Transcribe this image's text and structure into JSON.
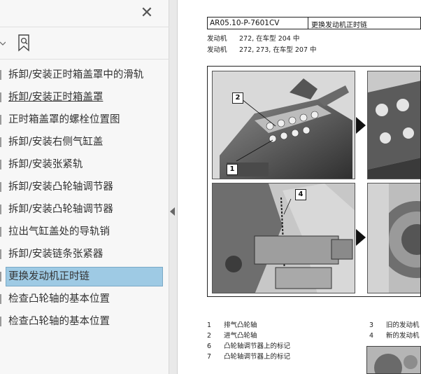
{
  "sidebar": {
    "close_glyph": "✕",
    "bookmarks": [
      {
        "label": "拆卸/安装正时箱盖罩中的滑轨"
      },
      {
        "label": "拆卸/安装正时箱盖罩"
      },
      {
        "label": "正时箱盖罩的螺栓位置图"
      },
      {
        "label": "拆卸/安装右侧气缸盖"
      },
      {
        "label": "拆卸/安装张紧轨"
      },
      {
        "label": "拆卸/安装凸轮轴调节器"
      },
      {
        "label": "拆卸/安装凸轮轴调节器"
      },
      {
        "label": "拉出气缸盖处的导轨销"
      },
      {
        "label": "拆卸/安装链条张紧器"
      },
      {
        "label": "更换发动机正时链"
      },
      {
        "label": "检查凸轮轴的基本位置"
      },
      {
        "label": "检查凸轮轴的基本位置"
      }
    ],
    "selected_index": 9,
    "underlined_index": 1,
    "selection_color": "#9ecae4"
  },
  "document": {
    "code": "AR05.10-P-7601CV",
    "title": "更换发动机正时链",
    "engine_lines": [
      {
        "key": "发动机",
        "value": "272, 在车型 204 中"
      },
      {
        "key": "发动机",
        "value": "272, 273, 在车型 207 中"
      }
    ],
    "figure_callouts": [
      "2",
      "1",
      "4"
    ],
    "legend_left": [
      {
        "n": "1",
        "text": "排气凸轮轴"
      },
      {
        "n": "2",
        "text": "进气凸轮轴"
      },
      {
        "n": "6",
        "text": "凸轮轴调节器上的标记"
      },
      {
        "n": "7",
        "text": "凸轮轴调节器上的标记"
      }
    ],
    "legend_right": [
      {
        "n": "3",
        "text": "旧的发动机"
      },
      {
        "n": "4",
        "text": "新的发动机"
      }
    ]
  },
  "icons": {
    "close": "close-icon",
    "bookmark_tool": "bookmark-search-icon",
    "chevron": "chevron-down-icon",
    "collapse": "collapse-panel-arrow-icon",
    "figure_arrow": "arrow-right-icon"
  }
}
